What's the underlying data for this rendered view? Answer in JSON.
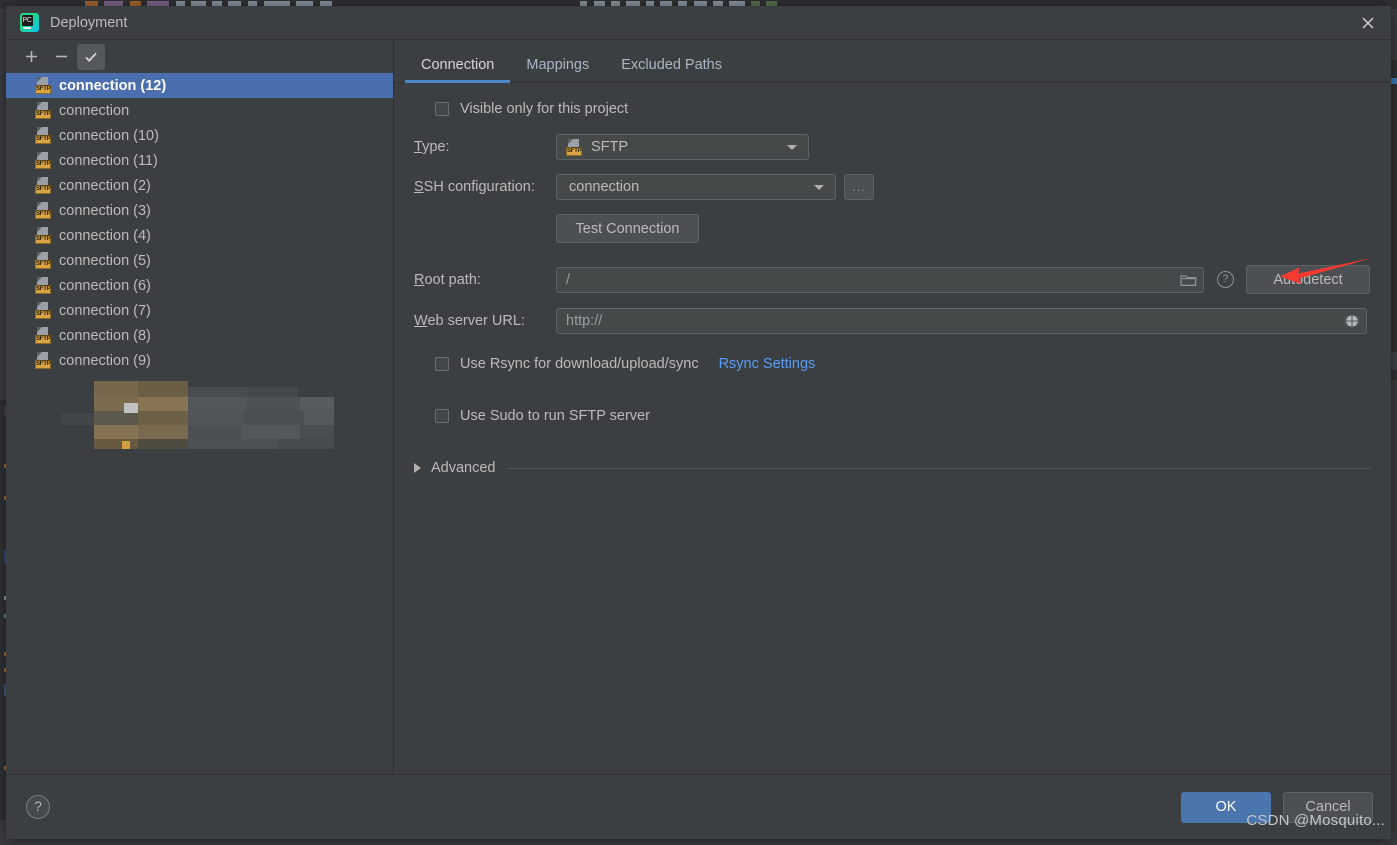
{
  "window": {
    "title": "Deployment",
    "app_icon": "pycharm-logo-icon",
    "close_icon": "close-icon"
  },
  "list_toolbar": {
    "add_label": "+",
    "remove_label": "−",
    "use_as_default_icon": "checkmark-icon"
  },
  "connections": {
    "items": [
      {
        "label": "connection (12)",
        "selected": true
      },
      {
        "label": "connection",
        "selected": false
      },
      {
        "label": "connection (10)",
        "selected": false
      },
      {
        "label": "connection (11)",
        "selected": false
      },
      {
        "label": "connection (2)",
        "selected": false
      },
      {
        "label": "connection (3)",
        "selected": false
      },
      {
        "label": "connection (4)",
        "selected": false
      },
      {
        "label": "connection (5)",
        "selected": false
      },
      {
        "label": "connection (6)",
        "selected": false
      },
      {
        "label": "connection (7)",
        "selected": false
      },
      {
        "label": "connection (8)",
        "selected": false
      },
      {
        "label": "connection (9)",
        "selected": false
      }
    ],
    "item_icon": "sftp-file-icon",
    "icon_badge_text": "SFTP"
  },
  "tabs": [
    {
      "label": "Connection",
      "active": true
    },
    {
      "label": "Mappings",
      "active": false
    },
    {
      "label": "Excluded Paths",
      "active": false
    }
  ],
  "connection_form": {
    "visible_only_label": "Visible only for this project",
    "visible_only_checked": false,
    "type_label": "Type:",
    "type_mnemonic": "T",
    "type_value": "SFTP",
    "type_icon": "sftp-file-icon",
    "ssh_label": "SSH configuration:",
    "ssh_mnemonic": "S",
    "ssh_value": "connection",
    "ssh_browse_label": "...",
    "test_connection_label": "Test Connection",
    "test_connection_mnemonic": "C",
    "root_path_label": "Root path:",
    "root_path_mnemonic": "R",
    "root_path_value": "/",
    "root_path_browse_icon": "folder-icon",
    "root_path_help_icon": "help-icon",
    "autodetect_label": "Autodetect",
    "web_url_label": "Web server URL:",
    "web_url_mnemonic": "W",
    "web_url_value": "http://",
    "web_url_open_icon": "globe-icon",
    "rsync_label": "Use Rsync for download/upload/sync",
    "rsync_checked": false,
    "rsync_settings_link": "Rsync Settings",
    "sudo_label": "Use Sudo to run SFTP server",
    "sudo_checked": false,
    "advanced_label": "Advanced",
    "advanced_expanded": false,
    "advanced_icon": "chevron-right-icon"
  },
  "annotation": {
    "arrow_icon": "red-arrow-left-icon",
    "arrow_color": "#f83a31"
  },
  "footer": {
    "help_icon": "help-icon",
    "help_label": "?",
    "ok_label": "OK",
    "cancel_label": "Cancel"
  },
  "watermark": {
    "text": "CSDN @Mosquito..."
  },
  "colors": {
    "dialog_bg": "#3c3f41",
    "selection_blue": "#4b6eaf",
    "tab_accent": "#4a88c7",
    "link_blue": "#589df6",
    "ok_blue": "#4a75ad",
    "sftp_badge": "#d9a443"
  }
}
